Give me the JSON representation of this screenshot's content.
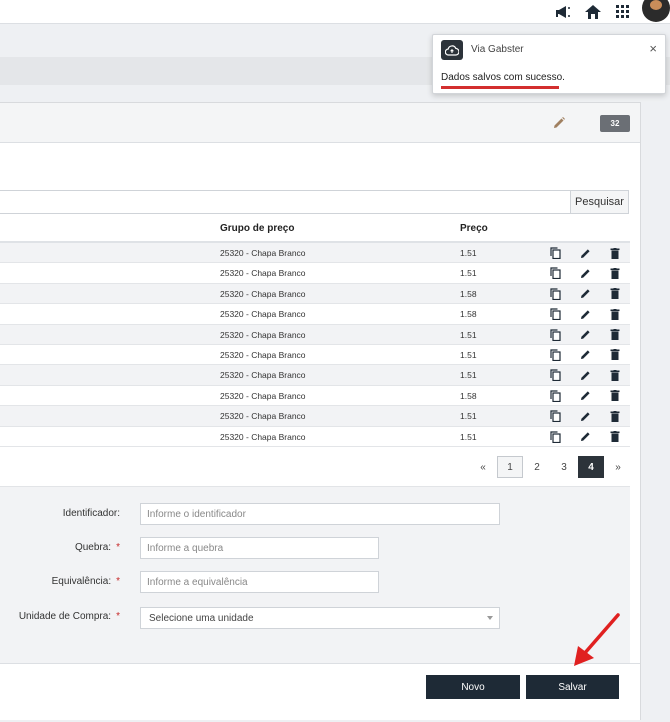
{
  "toast": {
    "title": "Via Gabster",
    "message": "Dados salvos com sucesso.",
    "close": "×"
  },
  "panel": {
    "count_badge": "32"
  },
  "search": {
    "value": "",
    "button_label": "Pesquisar"
  },
  "table": {
    "headers": {
      "grupo": "Grupo de preço",
      "preco": "Preço"
    },
    "rows": [
      {
        "grupo": "25320 - Chapa Branco",
        "preco": "1.51"
      },
      {
        "grupo": "25320 - Chapa Branco",
        "preco": "1.51"
      },
      {
        "grupo": "25320 - Chapa Branco",
        "preco": "1.58"
      },
      {
        "grupo": "25320 - Chapa Branco",
        "preco": "1.58"
      },
      {
        "grupo": "25320 - Chapa Branco",
        "preco": "1.51"
      },
      {
        "grupo": "25320 - Chapa Branco",
        "preco": "1.51"
      },
      {
        "grupo": "25320 - Chapa Branco",
        "preco": "1.51"
      },
      {
        "grupo": "25320 - Chapa Branco",
        "preco": "1.58"
      },
      {
        "grupo": "25320 - Chapa Branco",
        "preco": "1.51"
      },
      {
        "grupo": "25320 - Chapa Branco",
        "preco": "1.51"
      }
    ],
    "row_icons": [
      "copy-icon",
      "pencil-icon",
      "trash-icon"
    ]
  },
  "pagination": {
    "prev": "«",
    "pages": [
      "1",
      "2",
      "3",
      "4"
    ],
    "current_page": "4",
    "next": "»"
  },
  "form": {
    "identificador": {
      "label": "Identificador:",
      "placeholder": "Informe o identificador"
    },
    "quebra": {
      "label": "Quebra:",
      "placeholder": "Informe a quebra",
      "required": "*"
    },
    "equivalencia": {
      "label": "Equivalência:",
      "placeholder": "Informe a equivalência",
      "required": "*"
    },
    "unidade": {
      "label": "Unidade de Compra:",
      "placeholder": "Selecione uma unidade",
      "required": "*"
    }
  },
  "actions": {
    "novo": "Novo",
    "salvar": "Salvar"
  },
  "colors": {
    "dark_button": "#1e2a36",
    "required": "#c62828",
    "highlight_arrow": "#e02020",
    "badge": "#6b6f75"
  },
  "topbar_icons": [
    "megaphone-icon",
    "home-icon",
    "apps-grid-icon",
    "avatar"
  ]
}
